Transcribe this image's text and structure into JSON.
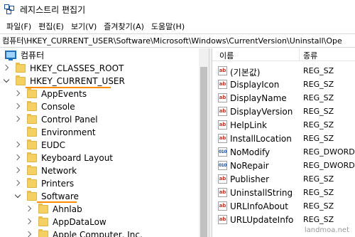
{
  "window": {
    "title": "레지스트리 편집기"
  },
  "menu": [
    "파일(F)",
    "편집(E)",
    "보기(V)",
    "즐겨찾기(A)",
    "도움말(H)"
  ],
  "address": {
    "path": "컴퓨터\\HKEY_CURRENT_USER\\Software\\Microsoft\\Windows\\CurrentVersion\\Uninstall\\Ope"
  },
  "tree": {
    "root": "컴퓨터",
    "items": [
      {
        "label": "HKEY_CLASSES_ROOT",
        "state": "collapsed"
      },
      {
        "label": "HKEY_CURRENT_USER",
        "state": "expanded"
      },
      {
        "label": "AppEvents",
        "state": "collapsed"
      },
      {
        "label": "Console",
        "state": "collapsed"
      },
      {
        "label": "Control Panel",
        "state": "collapsed"
      },
      {
        "label": "Environment",
        "state": "collapsed"
      },
      {
        "label": "EUDC",
        "state": "collapsed"
      },
      {
        "label": "Keyboard Layout",
        "state": "collapsed"
      },
      {
        "label": "Network",
        "state": "collapsed"
      },
      {
        "label": "Printers",
        "state": "collapsed"
      },
      {
        "label": "Software",
        "state": "expanded"
      },
      {
        "label": "Ahnlab",
        "state": "collapsed"
      },
      {
        "label": "AppDataLow",
        "state": "collapsed"
      },
      {
        "label": "Apple Computer, Inc.",
        "state": "collapsed"
      }
    ]
  },
  "values": {
    "header_name": "이름",
    "header_type": "종류",
    "rows": [
      {
        "icon": "ab",
        "name": "(기본값)",
        "type": "REG_SZ"
      },
      {
        "icon": "ab",
        "name": "DisplayIcon",
        "type": "REG_SZ"
      },
      {
        "icon": "ab",
        "name": "DisplayName",
        "type": "REG_SZ"
      },
      {
        "icon": "ab",
        "name": "DisplayVersion",
        "type": "REG_SZ"
      },
      {
        "icon": "ab",
        "name": "HelpLink",
        "type": "REG_SZ"
      },
      {
        "icon": "ab",
        "name": "InstallLocation",
        "type": "REG_SZ"
      },
      {
        "icon": "010",
        "name": "NoModify",
        "type": "REG_DWORD"
      },
      {
        "icon": "010",
        "name": "NoRepair",
        "type": "REG_DWORD"
      },
      {
        "icon": "ab",
        "name": "Publisher",
        "type": "REG_SZ"
      },
      {
        "icon": "ab",
        "name": "UninstallString",
        "type": "REG_SZ"
      },
      {
        "icon": "ab",
        "name": "URLInfoAbout",
        "type": "REG_SZ"
      },
      {
        "icon": "ab",
        "name": "URLUpdateInfo",
        "type": "REG_SZ"
      }
    ]
  },
  "watermark": "landmoa.net",
  "colors": {
    "highlight": "#ff8c00",
    "folder": "#f4cf62"
  }
}
